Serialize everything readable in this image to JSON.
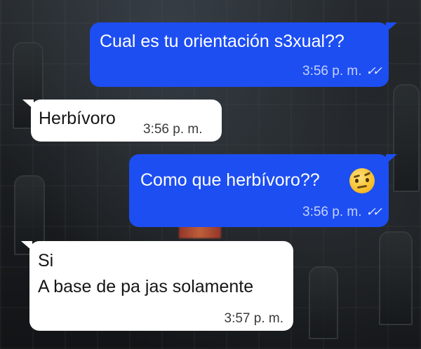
{
  "chat": {
    "messages": [
      {
        "direction": "outgoing",
        "text": "Cual es tu orientación s3xual??",
        "time": "3:56 p. m.",
        "status": "read"
      },
      {
        "direction": "incoming",
        "text": "Herbívoro",
        "time": "3:56 p. m."
      },
      {
        "direction": "outgoing",
        "text": "Como que herbívoro??",
        "emoji": "raised-eyebrow-face",
        "time": "3:56 p. m.",
        "status": "read"
      },
      {
        "direction": "incoming",
        "lines": [
          "Si",
          "A base de pa jas solamente"
        ],
        "time": "3:57 p. m."
      }
    ]
  },
  "colors": {
    "outgoing_bubble": "#1d4ef2",
    "incoming_bubble": "#ffffff",
    "background": "#15181b"
  },
  "icons": {
    "read_receipt": "double-check-icon"
  }
}
